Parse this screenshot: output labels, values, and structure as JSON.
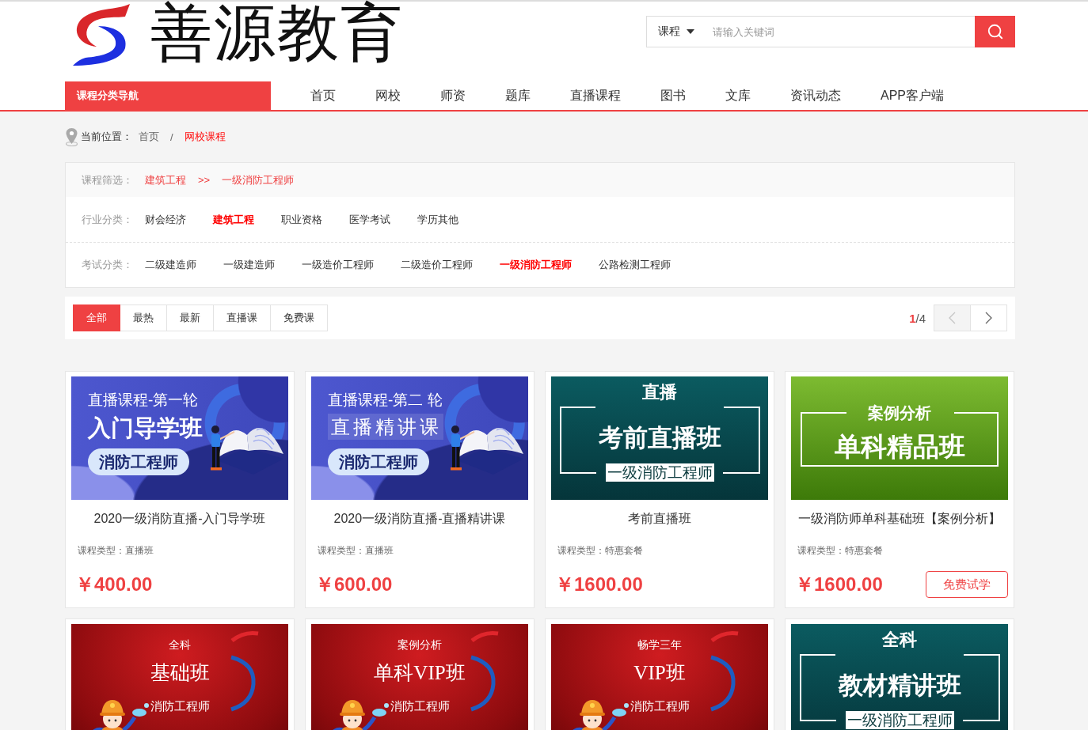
{
  "logo": {
    "text": "善源教育"
  },
  "search": {
    "scope": "课程",
    "placeholder": "请输入关键词"
  },
  "nav": {
    "category_button": "课程分类导航",
    "items": [
      {
        "label": "首页"
      },
      {
        "label": "网校"
      },
      {
        "label": "师资"
      },
      {
        "label": "题库"
      },
      {
        "label": "直播课程"
      },
      {
        "label": "图书"
      },
      {
        "label": "文库"
      },
      {
        "label": "资讯动态"
      },
      {
        "label": "APP客户端"
      }
    ]
  },
  "breadcrumb": {
    "label": "当前位置：",
    "separator": "/",
    "items": [
      {
        "label": "首页",
        "current": false
      },
      {
        "label": "网校课程",
        "current": true
      }
    ]
  },
  "filters": {
    "summary": {
      "label": "课程筛选：",
      "separator": ">>",
      "items": [
        "建筑工程",
        "一级消防工程师"
      ]
    },
    "rows": [
      {
        "label": "行业分类：",
        "options": [
          {
            "label": "财会经济",
            "selected": false
          },
          {
            "label": "建筑工程",
            "selected": true
          },
          {
            "label": "职业资格",
            "selected": false
          },
          {
            "label": "医学考试",
            "selected": false
          },
          {
            "label": "学历其他",
            "selected": false
          }
        ]
      },
      {
        "label": "考试分类：",
        "options": [
          {
            "label": "二级建造师",
            "selected": false
          },
          {
            "label": "一级建造师",
            "selected": false
          },
          {
            "label": "一级造价工程师",
            "selected": false
          },
          {
            "label": "二级造价工程师",
            "selected": false
          },
          {
            "label": "一级消防工程师",
            "selected": true
          },
          {
            "label": "公路检测工程师",
            "selected": false
          }
        ]
      }
    ]
  },
  "sort_tabs": [
    {
      "label": "全部",
      "selected": true
    },
    {
      "label": "最热",
      "selected": false
    },
    {
      "label": "最新",
      "selected": false
    },
    {
      "label": "直播课",
      "selected": false
    },
    {
      "label": "免费课",
      "selected": false
    }
  ],
  "pager": {
    "current": "1",
    "separator": "/",
    "total": "4",
    "prev_disabled": true,
    "next_disabled": false
  },
  "courses": [
    {
      "banner": {
        "kind": "blue",
        "top": "直播课程-第一轮",
        "headline": "入门导学班",
        "headline_boxed": false,
        "tag": "消防工程师"
      },
      "title": "2020一级消防直播-入门导学班",
      "type": "课程类型：直播班",
      "price": "￥400.00"
    },
    {
      "banner": {
        "kind": "blue",
        "top": "直播课程-第二 轮",
        "headline": "直播精讲课",
        "headline_boxed": true,
        "tag": "消防工程师"
      },
      "title": "2020一级消防直播-直播精讲课",
      "type": "课程类型：直播班",
      "price": "￥600.00"
    },
    {
      "banner": {
        "kind": "teal",
        "top": "直播",
        "headline": "考前直播班",
        "tag": "一级消防工程师"
      },
      "title": "考前直播班",
      "type": "课程类型：特惠套餐",
      "price": "￥1600.00"
    },
    {
      "banner": {
        "kind": "green",
        "top": "案例分析",
        "headline": "单科精品班"
      },
      "title": "一级消防师单科基础班【案例分析】",
      "type": "课程类型：特惠套餐",
      "price": "￥1600.00",
      "trial_button": "免费试学"
    },
    {
      "banner": {
        "kind": "red",
        "top": "全科",
        "headline": "基础班",
        "tag": "消防工程师"
      }
    },
    {
      "banner": {
        "kind": "red",
        "top": "案例分析",
        "headline": "单科VIP班",
        "tag": "消防工程师"
      }
    },
    {
      "banner": {
        "kind": "red",
        "top": "畅学三年",
        "headline": "VIP班",
        "tag": "消防工程师"
      }
    },
    {
      "banner": {
        "kind": "teal",
        "top": "全科",
        "headline": "教材精讲班",
        "tag": "一级消防工程师"
      }
    }
  ]
}
